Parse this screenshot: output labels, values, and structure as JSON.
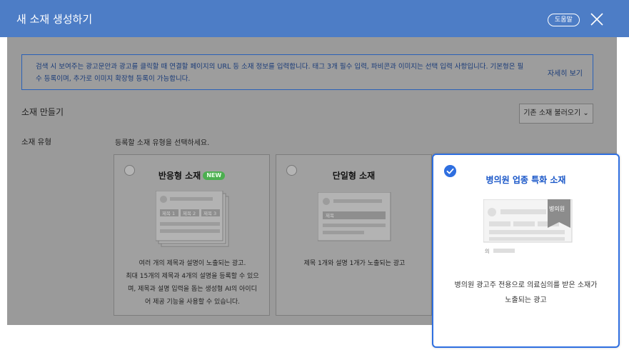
{
  "header": {
    "title": "새 소재 생성하기",
    "help_label": "도움말"
  },
  "notice": {
    "text": "검색 시 보여주는 광고문안과 광고를 클릭할 때 연결할 페이지의 URL 등 소재 정보를 입력합니다. 태그 3개 필수 입력, 파비콘과 이미지는 선택 입력 사항입니다. 기본형은 필수 등록이며, 추가로 이미지 확장형 등록이 가능합니다.",
    "more_label": "자세히 보기"
  },
  "section": {
    "title": "소재 만들기",
    "load_label": "기존 소재 불러오기 ⌄"
  },
  "type_row": {
    "label": "소재 유형",
    "hint": "등록할 소재 유형을 선택하세요."
  },
  "cards": [
    {
      "title": "반응형 소재",
      "badge": "NEW",
      "preview_labels": [
        "제목 1",
        "제목 2",
        "제목 3"
      ],
      "desc_lines": [
        "여러 개의 제목과 설명이 노출되는 광고.",
        "최대 15개의 제목과 4개의 설명을 등록할 수 있으",
        "며, 제목과 설명 입력을 돕는 생성형 AI의 아이디",
        "어 제공 기능을 사용할 수 있습니다."
      ]
    },
    {
      "title": "단일형 소재",
      "preview_label": "제목",
      "desc_lines": [
        "제목 1개와 설명 1개가 노출되는 광고"
      ]
    }
  ],
  "selected_card": {
    "title": "병의원 업종 특화 소재",
    "ribbon": "병의원",
    "preview_mark": "의",
    "desc_lines": [
      "병의원 광고주 전용으로 의료심의를 받은 소재가",
      "노출되는 광고"
    ]
  }
}
